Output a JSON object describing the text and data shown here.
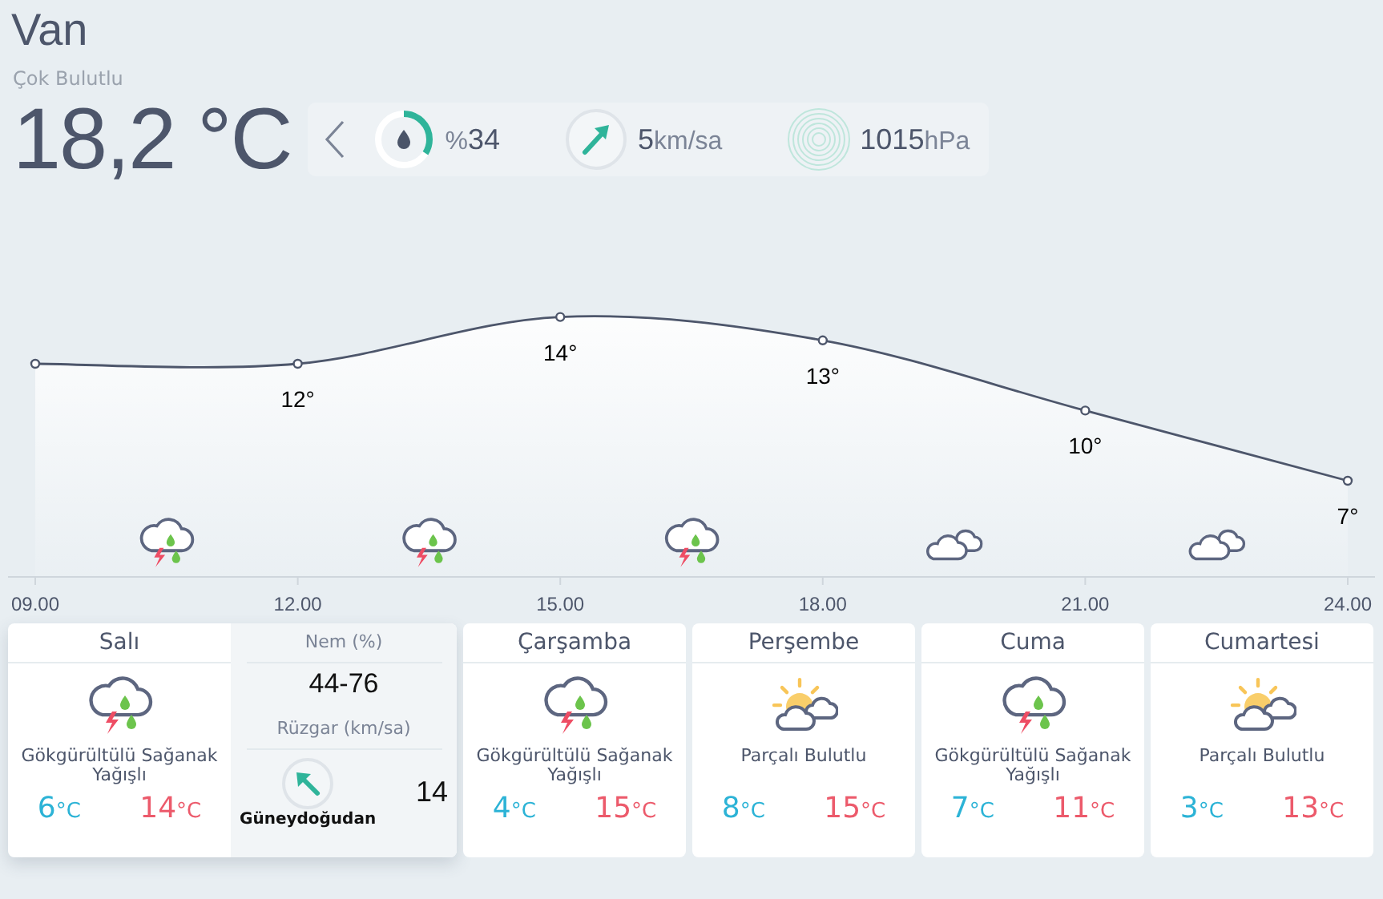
{
  "city": "Van",
  "condition": "Çok Bulutlu",
  "temperature": "18,2 °C",
  "current": {
    "humidity": {
      "prefix": "%",
      "value": "34",
      "level": 0.34
    },
    "wind": {
      "value": "5",
      "unit": "km/sa"
    },
    "pressure": {
      "value": "1015",
      "unit": "hPa"
    }
  },
  "hourly": {
    "chart_data": {
      "type": "area",
      "marker": true,
      "categories": [
        "09.00",
        "12.00",
        "15.00",
        "18.00",
        "21.00",
        "24.00"
      ],
      "values": [
        12,
        12,
        14,
        13,
        10,
        7
      ],
      "value_labels": [
        null,
        "12°",
        "14°",
        "13°",
        "10°",
        "7°"
      ]
    },
    "icons": [
      {
        "kind": "storm"
      },
      {
        "kind": "storm"
      },
      {
        "kind": "storm"
      },
      {
        "kind": "cloudy"
      },
      {
        "kind": "cloudy"
      }
    ]
  },
  "days": [
    {
      "name": "Salı",
      "kind": "storm",
      "condition": "Gökgürültülü Sağanak Yağışlı",
      "low": {
        "value": "6",
        "unit": "°C"
      },
      "high": {
        "value": "14",
        "unit": "°C"
      },
      "selected": true,
      "details": {
        "humidity_label": "Nem (%)",
        "humidity": "44-76",
        "wind_label": "Rüzgar (km/sa)",
        "wind_direction": "Güneydoğudan",
        "wind_speed": "14"
      }
    },
    {
      "name": "Çarşamba",
      "kind": "storm",
      "condition": "Gökgürültülü Sağanak Yağışlı",
      "low": {
        "value": "4",
        "unit": "°C"
      },
      "high": {
        "value": "15",
        "unit": "°C"
      },
      "selected": false
    },
    {
      "name": "Perşembe",
      "kind": "partly",
      "condition": "Parçalı Bulutlu",
      "low": {
        "value": "8",
        "unit": "°C"
      },
      "high": {
        "value": "15",
        "unit": "°C"
      },
      "selected": false
    },
    {
      "name": "Cuma",
      "kind": "storm",
      "condition": "Gökgürültülü Sağanak Yağışlı",
      "low": {
        "value": "7",
        "unit": "°C"
      },
      "high": {
        "value": "11",
        "unit": "°C"
      },
      "selected": false
    },
    {
      "name": "Cumartesi",
      "kind": "partly",
      "condition": "Parçalı Bulutlu",
      "low": {
        "value": "3",
        "unit": "°C"
      },
      "high": {
        "value": "13",
        "unit": "°C"
      },
      "selected": false
    }
  ]
}
